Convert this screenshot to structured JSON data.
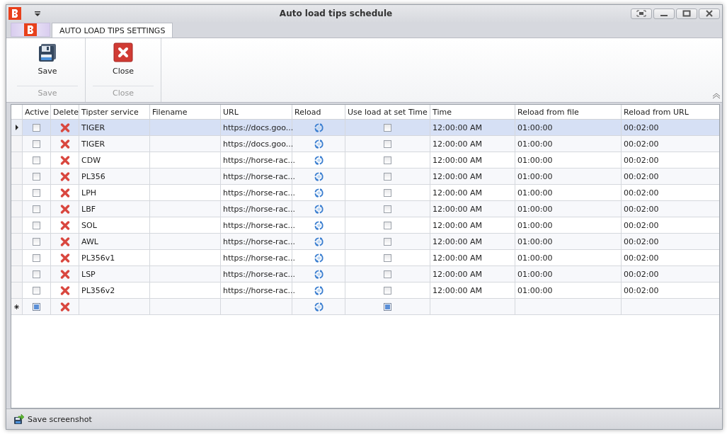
{
  "window": {
    "title": "Auto load tips schedule"
  },
  "ribbon": {
    "tabs": [
      {
        "label": "AUTO LOAD TIPS SETTINGS",
        "selected": true
      }
    ],
    "groups": [
      {
        "label": "Save",
        "button": {
          "label": "Save"
        }
      },
      {
        "label": "Close",
        "button": {
          "label": "Close"
        }
      }
    ]
  },
  "table": {
    "columns": [
      "Active",
      "Delete",
      "Tipster service",
      "Filename",
      "URL",
      "Reload",
      "Use load at set Time",
      "Time",
      "Reload from file",
      "Reload from URL"
    ],
    "rows": [
      {
        "kind": "data",
        "selected": true,
        "active": false,
        "tipster": "TIGER",
        "url": "https://docs.goo...",
        "use_load": false,
        "time": "12:00:00 AM",
        "reload_file": "01:00:00",
        "reload_url": "00:02:00"
      },
      {
        "kind": "data",
        "selected": false,
        "active": false,
        "tipster": "TIGER",
        "url": "https://docs.goo...",
        "use_load": false,
        "time": "12:00:00 AM",
        "reload_file": "01:00:00",
        "reload_url": "00:02:00"
      },
      {
        "kind": "data",
        "selected": false,
        "active": false,
        "tipster": "CDW",
        "url": "https://horse-rac...",
        "use_load": false,
        "time": "12:00:00 AM",
        "reload_file": "01:00:00",
        "reload_url": "00:02:00"
      },
      {
        "kind": "data",
        "selected": false,
        "active": false,
        "tipster": "PL356",
        "url": "https://horse-rac...",
        "use_load": false,
        "time": "12:00:00 AM",
        "reload_file": "01:00:00",
        "reload_url": "00:02:00"
      },
      {
        "kind": "data",
        "selected": false,
        "active": false,
        "tipster": "LPH",
        "url": "https://horse-rac...",
        "use_load": false,
        "time": "12:00:00 AM",
        "reload_file": "01:00:00",
        "reload_url": "00:02:00"
      },
      {
        "kind": "data",
        "selected": false,
        "active": false,
        "tipster": "LBF",
        "url": "https://horse-rac...",
        "use_load": false,
        "time": "12:00:00 AM",
        "reload_file": "01:00:00",
        "reload_url": "00:02:00"
      },
      {
        "kind": "data",
        "selected": false,
        "active": false,
        "tipster": "SOL",
        "url": "https://horse-rac...",
        "use_load": false,
        "time": "12:00:00 AM",
        "reload_file": "01:00:00",
        "reload_url": "00:02:00"
      },
      {
        "kind": "data",
        "selected": false,
        "active": false,
        "tipster": "AWL",
        "url": "https://horse-rac...",
        "use_load": false,
        "time": "12:00:00 AM",
        "reload_file": "01:00:00",
        "reload_url": "00:02:00"
      },
      {
        "kind": "data",
        "selected": false,
        "active": false,
        "tipster": "PL356v1",
        "url": "https://horse-rac...",
        "use_load": false,
        "time": "12:00:00 AM",
        "reload_file": "01:00:00",
        "reload_url": "00:02:00"
      },
      {
        "kind": "data",
        "selected": false,
        "active": false,
        "tipster": "LSP",
        "url": "https://horse-rac...",
        "use_load": false,
        "time": "12:00:00 AM",
        "reload_file": "01:00:00",
        "reload_url": "00:02:00"
      },
      {
        "kind": "data",
        "selected": false,
        "active": false,
        "tipster": "PL356v2",
        "url": "https://horse-rac...",
        "use_load": false,
        "time": "12:00:00 AM",
        "reload_file": "01:00:00",
        "reload_url": "00:02:00"
      },
      {
        "kind": "new",
        "selected": false,
        "active": null,
        "use_load": null
      }
    ]
  },
  "status_bar": {
    "button": "Save screenshot"
  }
}
